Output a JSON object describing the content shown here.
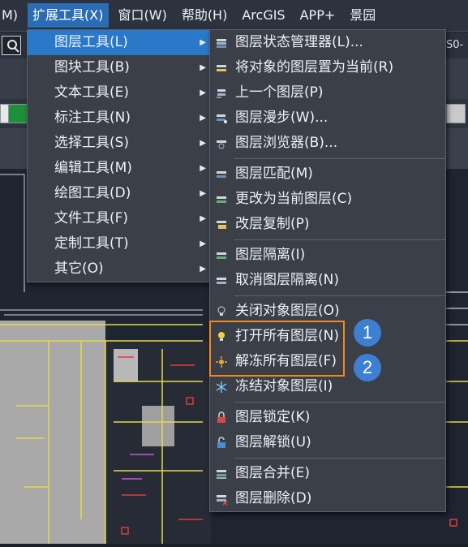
{
  "menubar": {
    "items": [
      {
        "label": "M)",
        "active": false
      },
      {
        "label": "扩展工具(X)",
        "active": true
      },
      {
        "label": "窗口(W)",
        "active": false
      },
      {
        "label": "帮助(H)",
        "active": false
      },
      {
        "label": "ArcGIS",
        "active": false
      },
      {
        "label": "APP+",
        "active": false
      },
      {
        "label": "景园",
        "active": false
      }
    ]
  },
  "toolbar": {
    "right_label": "S0-"
  },
  "main_menu": {
    "items": [
      {
        "label": "图层工具(L)",
        "selected": true
      },
      {
        "label": "图块工具(B)",
        "selected": false
      },
      {
        "label": "文本工具(E)",
        "selected": false
      },
      {
        "label": "标注工具(N)",
        "selected": false
      },
      {
        "label": "选择工具(S)",
        "selected": false
      },
      {
        "label": "编辑工具(M)",
        "selected": false
      },
      {
        "label": "绘图工具(D)",
        "selected": false
      },
      {
        "label": "文件工具(F)",
        "selected": false
      },
      {
        "label": "定制工具(T)",
        "selected": false
      },
      {
        "label": "其它(O)",
        "selected": false
      }
    ]
  },
  "sub_menu": {
    "groups": [
      [
        "图层状态管理器(L)...",
        "将对象的图层置为当前(R)",
        "上一个图层(P)",
        "图层漫步(W)...",
        "图层浏览器(B)..."
      ],
      [
        "图层匹配(M)",
        "更改为当前图层(C)",
        "改层复制(P)"
      ],
      [
        "图层隔离(I)",
        "取消图层隔离(N)"
      ],
      [
        "关闭对象图层(O)",
        "打开所有图层(N)",
        "解冻所有图层(F)",
        "冻结对象图层(I)"
      ],
      [
        "图层锁定(K)",
        "图层解锁(U)"
      ],
      [
        "图层合并(E)",
        "图层删除(D)"
      ]
    ]
  },
  "badges": [
    "1",
    "2"
  ],
  "colors": {
    "accent": "#2a79c9",
    "highlight": "#f08a1c",
    "badge": "#3d80d2"
  }
}
